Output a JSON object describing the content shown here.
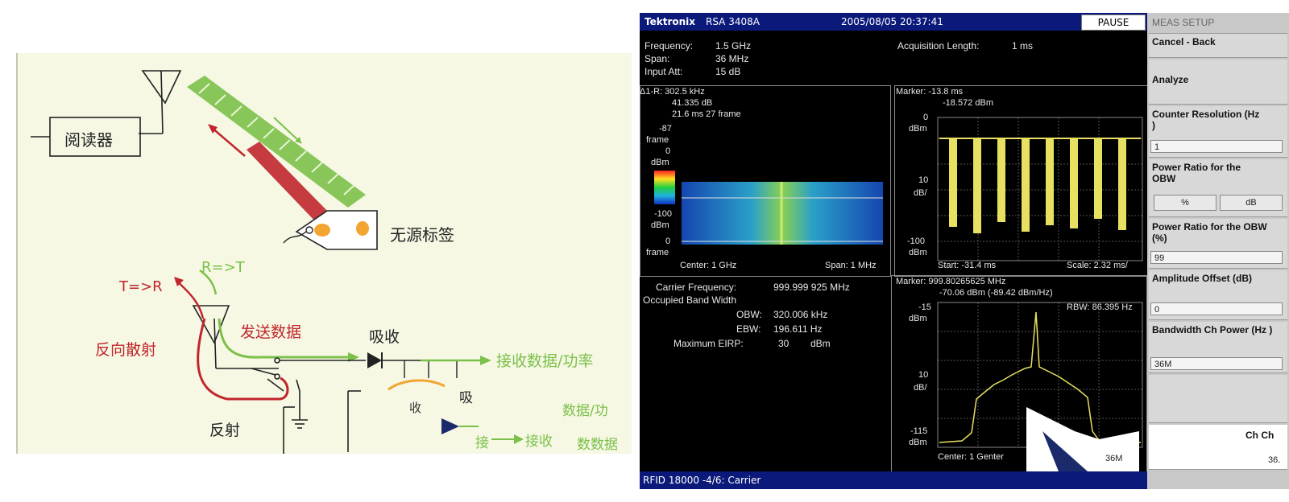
{
  "diagram": {
    "reader_label": "阅读器",
    "tag_label": "无源标签",
    "r_to_t": "R=>T",
    "t_to_r": "T=>R",
    "send_data": "发送数据",
    "backscatter": "反向散射",
    "absorb": "吸收",
    "receive_data_power": "接收数据/功率",
    "reflect": "反射",
    "absorb_small_1": "收",
    "absorb_small_2": "吸",
    "frag_data_power": "数据/功",
    "frag_receive": "接收",
    "frag_receive_data": "数数据",
    "frag_misc": "接",
    "colors": {
      "green": "#7cc04a",
      "red": "#c0262c",
      "tag_orange": "#f3a531"
    }
  },
  "analyzer": {
    "brand": "Tektronix",
    "model": "RSA 3408A",
    "datetime": "2005/08/05 20:37:41",
    "pause_label": "PAUSE",
    "frequency_label": "Frequency:",
    "frequency_value": "1.5 GHz",
    "span_label": "Span:",
    "span_value": "36 MHz",
    "input_att_label": "Input Att:",
    "input_att_value": "15 dB",
    "acq_length_label": "Acquisition Length:",
    "acq_length_value": "1 ms",
    "spectrogram": {
      "delta_line1": "Δ1-R: 302.5 kHz",
      "delta_line2": "41.335 dB",
      "delta_line3": "21.6 ms   27 frame",
      "frame_top": "-87",
      "frame_top_unit": "frame",
      "frame_zero": "0",
      "dbm_unit": "dBm",
      "minus100": "-100",
      "dbm_unit2": "dBm",
      "frame_bottom": "0",
      "frame_bottom_unit": "frame",
      "center": "Center: 1 GHz",
      "span": "Span: 1 MHz"
    },
    "time_domain": {
      "marker_line1": "Marker: -13.8 ms",
      "marker_line2": "-18.572 dBm",
      "y_top": "0",
      "y_top_unit": "dBm",
      "y_scale": "10",
      "y_scale_unit": "dB/",
      "y_bottom": "-100",
      "y_bottom_unit": "dBm",
      "start": "Start: -31.4 ms",
      "scale": "Scale: 2.32 ms/"
    },
    "carrier": {
      "carrier_freq_label": "Carrier Frequency:",
      "carrier_freq_value": "999.999 925 MHz",
      "occupied_bw_label": "Occupied Band Width",
      "obw_label": "OBW:",
      "obw_value": "320.006 kHz",
      "ebw_label": "EBW:",
      "ebw_value": "196.611 Hz",
      "eirp_label": "Maximum EIRP:",
      "eirp_value": "30",
      "eirp_unit": "dBm"
    },
    "spectrum": {
      "marker_line1": "Marker: 999.80265625 MHz",
      "marker_line2": "-70.06 dBm (-89.42 dBm/Hz)",
      "rbw": "RBW: 86.395 Hz",
      "y_top": "-15",
      "y_top_unit": "dBm",
      "y_scale": "10",
      "y_scale_unit": "dB/",
      "y_bottom": "-115",
      "y_bottom_unit": "dBm",
      "center": "Center: 1 Genter"
    },
    "status": "RFID 18000 -4/6: Carrier",
    "menu": {
      "title": "MEAS SETUP",
      "cancel_back": "Cancel - Back",
      "analyze": "Analyze",
      "counter_res_label": "Counter Resolution (Hz )",
      "counter_res_value": "1",
      "power_ratio_obw_label": "Power Ratio for the OBW",
      "pct_button": "%",
      "db_button": "dB",
      "power_ratio_obw_pct_label": "Power Ratio for the OBW (%)",
      "power_ratio_obw_pct_value": "99",
      "amp_offset_label": "Amplitude Offset (dB)",
      "amp_offset_value": "0",
      "bw_ch_power_label": "Bandwidth Ch Power (Hz )",
      "bw_ch_power_value": "36M",
      "ch_ch": "Ch Ch",
      "frag_36": "36.",
      "frag_36m": "36M"
    }
  }
}
